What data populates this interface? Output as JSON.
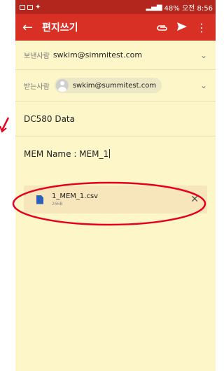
{
  "status_bar": {
    "right_text": "48% 오전 8:56"
  },
  "toolbar": {
    "back_icon": "arrow-left-icon",
    "title": "편지쓰기",
    "attach_icon": "paperclip-icon",
    "send_icon": "send-icon",
    "more_icon": "more-vert-icon"
  },
  "from": {
    "label": "보낸사람",
    "value": "swkim@simmitest.com",
    "chevron": "⌄"
  },
  "to": {
    "label": "받는사람",
    "recipient": "swkim@summitest.com",
    "chevron": "⌄"
  },
  "subject": {
    "value": "DC580  Data"
  },
  "body": {
    "value": "MEM Name : MEM_1"
  },
  "attachment": {
    "name": "1_MEM_1.csv",
    "size": "266B",
    "close": "✕"
  },
  "colors": {
    "toolbar": "#d93025",
    "status_bar": "#b3261e",
    "background": "#fcf6c9",
    "annotation": "#e5001b"
  }
}
